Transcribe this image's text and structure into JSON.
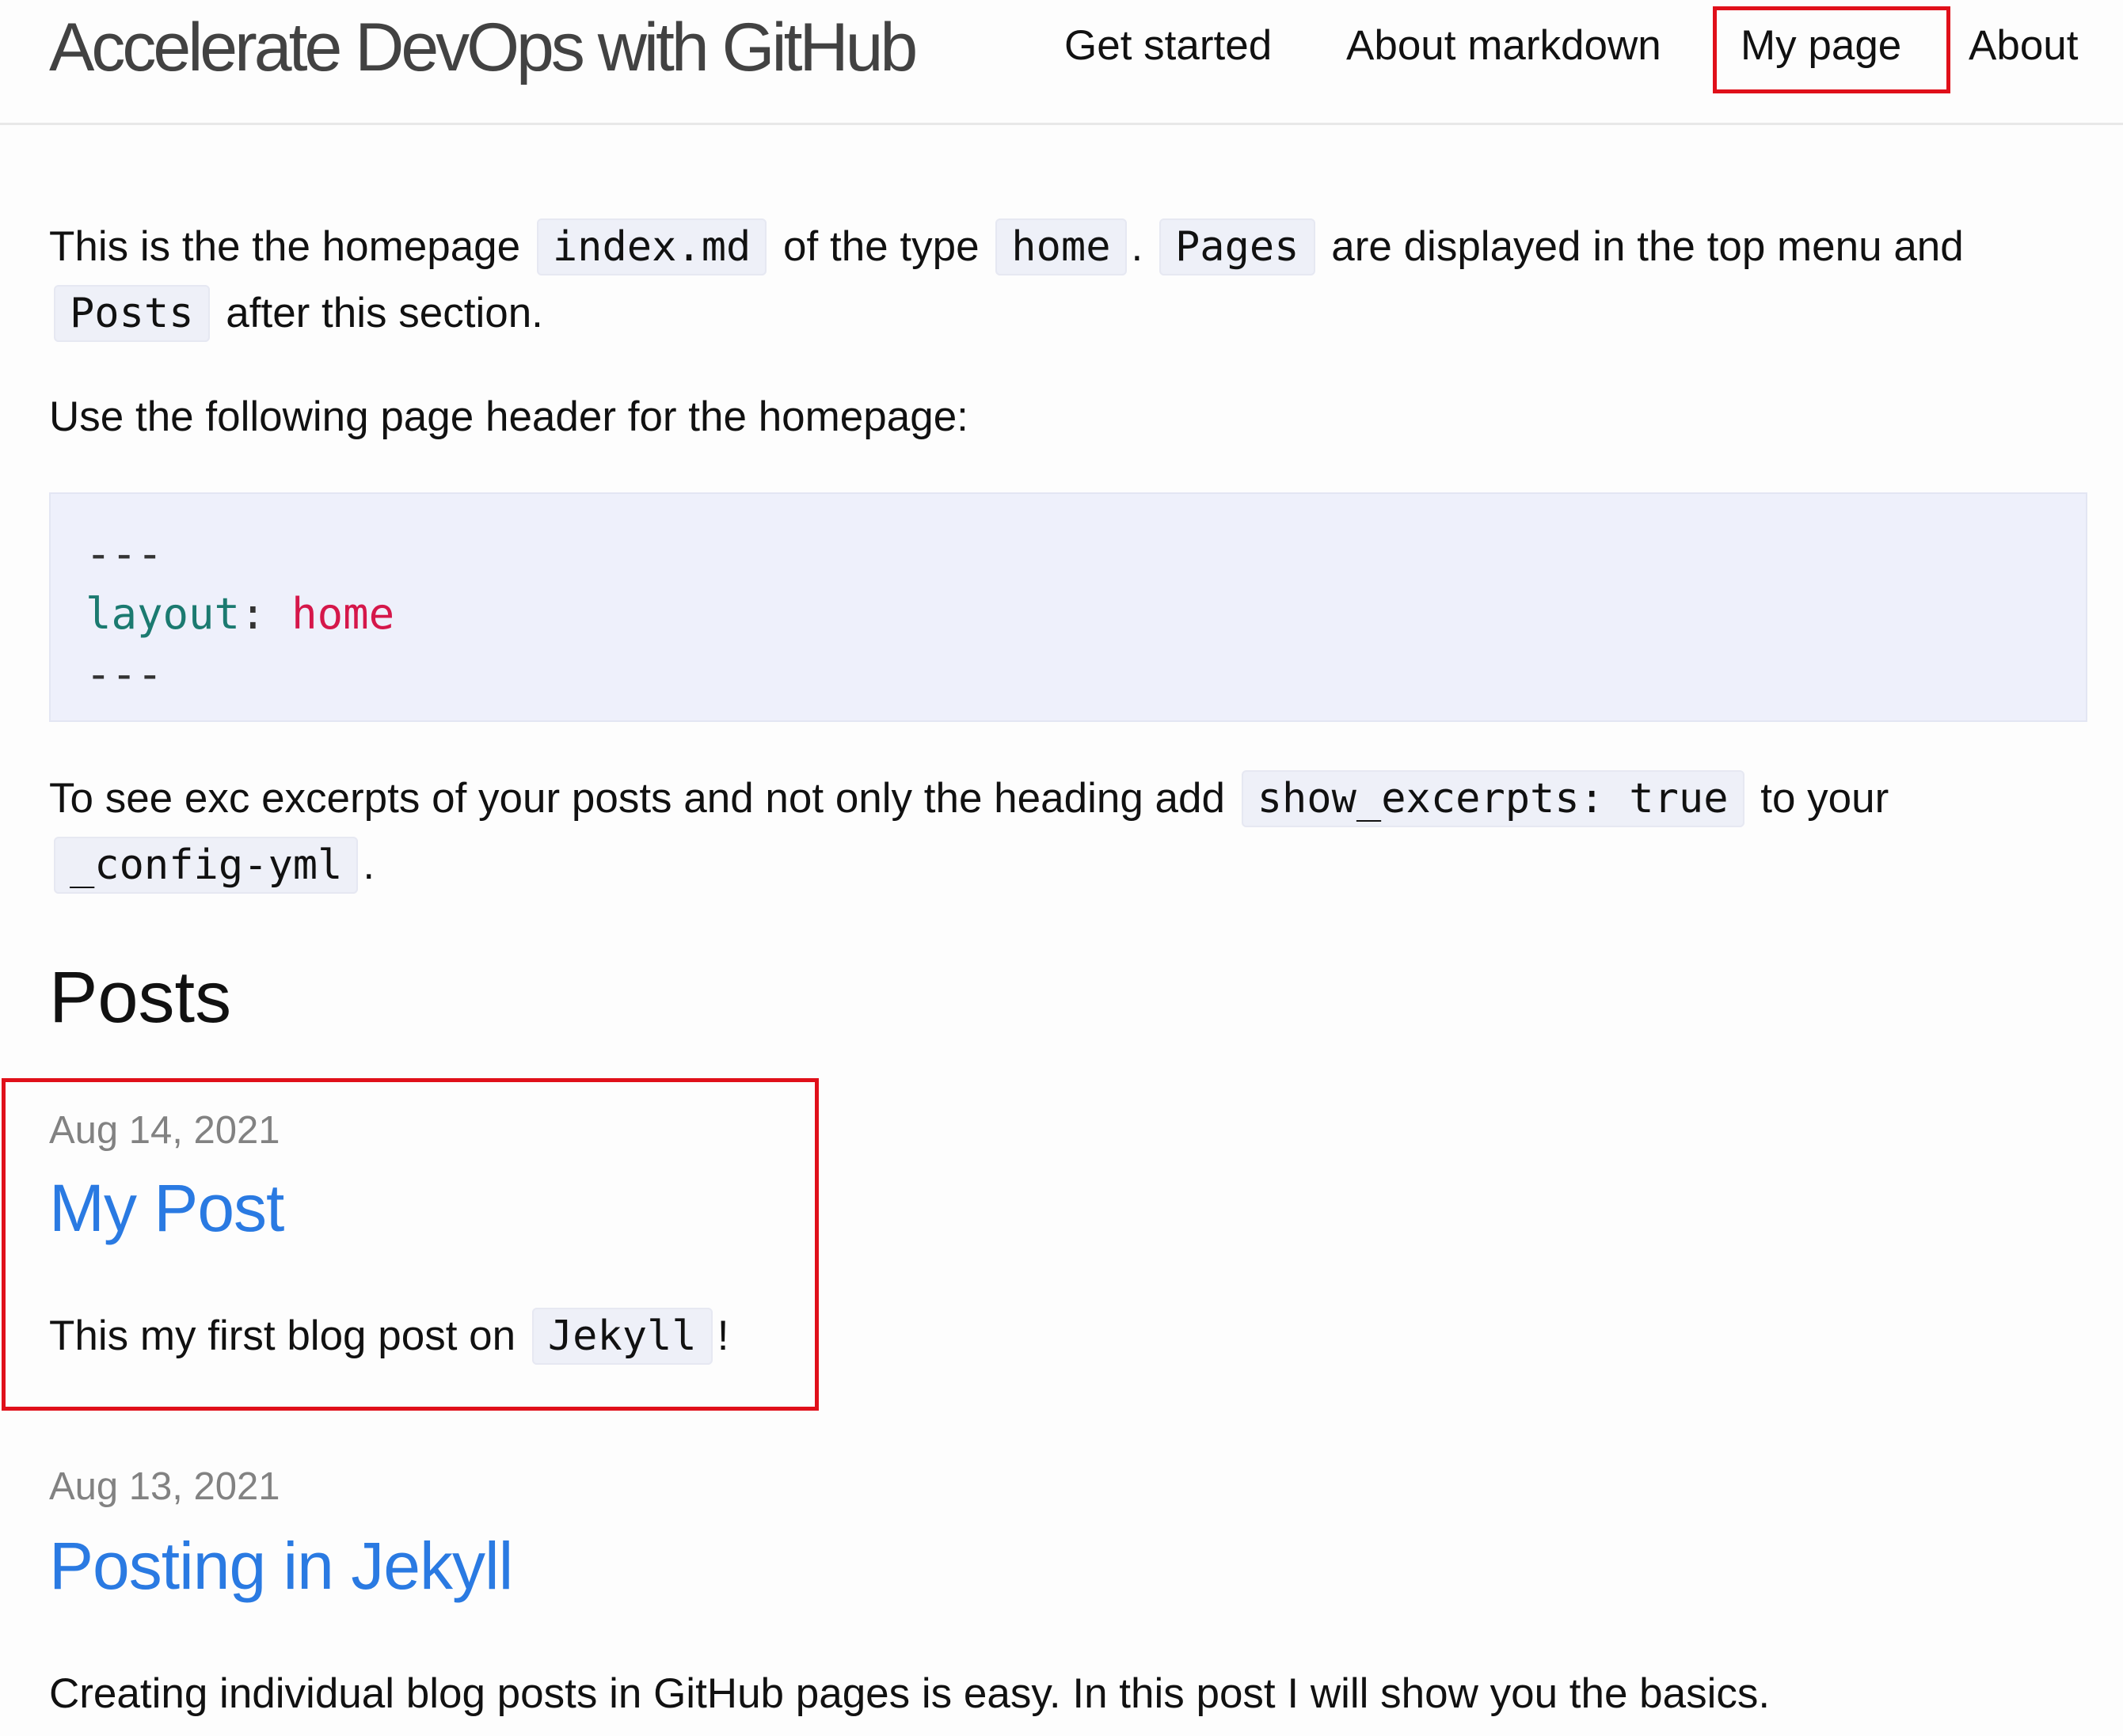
{
  "header": {
    "site_title": "Accelerate DevOps with GitHub",
    "nav": [
      {
        "label": "Get started"
      },
      {
        "label": "About markdown"
      },
      {
        "label": "My page"
      },
      {
        "label": "About"
      }
    ]
  },
  "intro": {
    "p1_text1": "This is the the homepage ",
    "p1_code1": "index.md",
    "p1_text2": " of the type ",
    "p1_code2": "home",
    "p1_text3": ". ",
    "p1_code3": "Pages",
    "p1_text4": " are displayed in the top menu and ",
    "p1_code4": "Posts",
    "p1_text5": " after this section.",
    "p2": "Use the following page header for the homepage:"
  },
  "codeblock": {
    "line1": "---",
    "key": "layout",
    "colon": ": ",
    "value": "home",
    "line3": "---"
  },
  "excerpts_note": {
    "text1": "To see exc excerpts of your posts and not only the heading add ",
    "code1": "show_excerpts: true",
    "text2": " to your ",
    "code2": "_config-yml",
    "text3": "."
  },
  "posts": {
    "heading": "Posts",
    "items": [
      {
        "date": "Aug 14, 2021",
        "title": "My Post",
        "excerpt_text": "This my first blog post on ",
        "excerpt_code": "Jekyll",
        "excerpt_end": "!"
      },
      {
        "date": "Aug 13, 2021",
        "title": "Posting in Jekyll",
        "excerpt_text": "Creating individual blog posts in GitHub pages is easy. In this post I will show you the basics."
      }
    ]
  },
  "colors": {
    "link": "#2a7ae2",
    "highlight_box": "#e0101a",
    "code_background": "#eef0fb"
  }
}
